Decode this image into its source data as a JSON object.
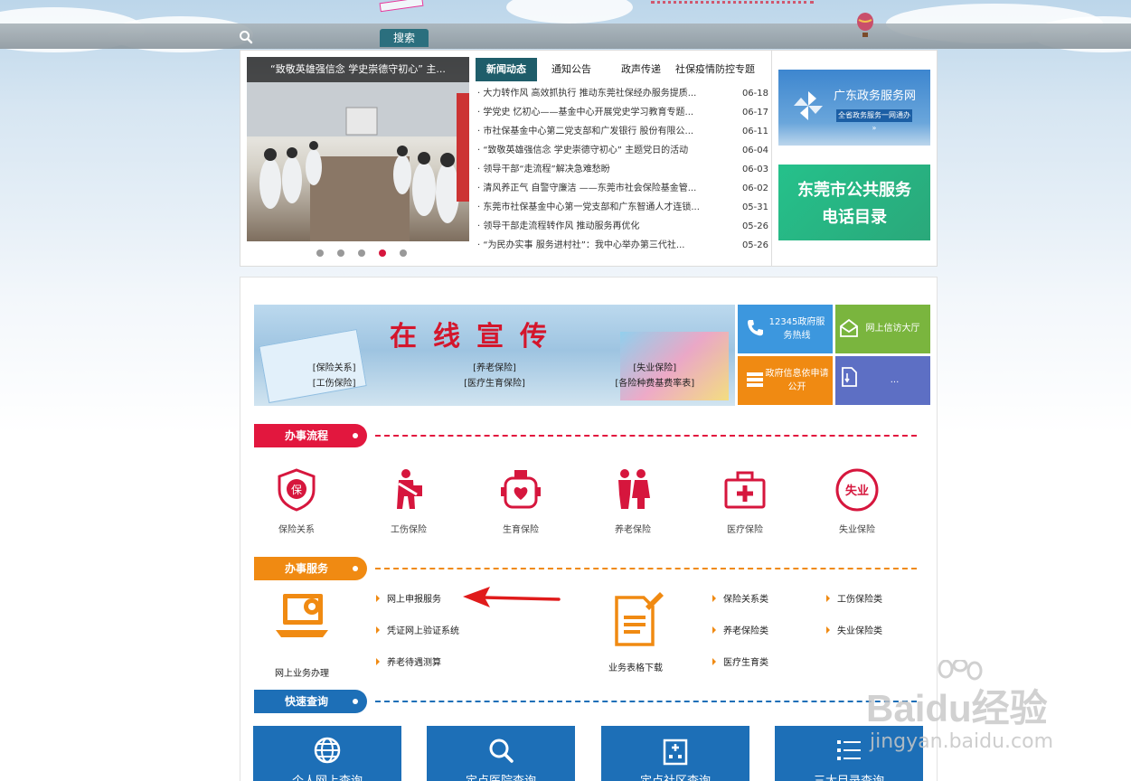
{
  "header": {
    "search_button": "搜索"
  },
  "slider": {
    "caption": "“致敬英雄强信念 学史崇德守初心” 主..."
  },
  "tabs": [
    {
      "label": "新闻动态",
      "active": true
    },
    {
      "label": "通知公告"
    },
    {
      "label": "政声传递"
    },
    {
      "label": "社保疫情防控专题"
    }
  ],
  "news": [
    {
      "title": "· 大力转作风 高效抓执行 推动东莞社保经办服务提质...",
      "date": "06-18"
    },
    {
      "title": "· 学党史 忆初心——基金中心开展党史学习教育专题...",
      "date": "06-17"
    },
    {
      "title": "· 市社保基金中心第二党支部和广发银行 股份有限公...",
      "date": "06-11"
    },
    {
      "title": "· “致敬英雄强信念 学史崇德守初心” 主题党日的活动",
      "date": "06-04"
    },
    {
      "title": "· 领导干部“走流程”解决急难愁盼",
      "date": "06-03"
    },
    {
      "title": "· 清风养正气 自警守廉洁 ——东莞市社会保险基金管...",
      "date": "06-02"
    },
    {
      "title": "· 东莞市社保基金中心第一党支部和广东智通人才连锁...",
      "date": "05-31"
    },
    {
      "title": "· 领导干部走流程转作风 推动服务再优化",
      "date": "05-26"
    },
    {
      "title": "· “为民办实事 服务进村社”：我中心举办第三代社...",
      "date": "05-26"
    }
  ],
  "right_banners": {
    "gd_title": "广东政务服务网",
    "gd_sub": "全省政务服务一网通办 »",
    "phone_line1": "东莞市公共服务",
    "phone_line2": "电话目录"
  },
  "promo": {
    "title": "在线宣传",
    "links_row1": [
      "[保险关系]",
      "[养老保险]",
      "[失业保险]"
    ],
    "links_row2": [
      "[工伤保险]",
      "[医疗生育保险]",
      "[各险种费基费率表]"
    ]
  },
  "tiles": {
    "hotline": "12345政府服务热线",
    "letters": "网上信访大厅",
    "disclosure": "政府信息依申请公开",
    "more": "..."
  },
  "sections": {
    "process": "办事流程",
    "service": "办事服务",
    "query": "快速查询"
  },
  "process_items": [
    "保险关系",
    "工伤保险",
    "生育保险",
    "养老保险",
    "医疗保险",
    "失业保险"
  ],
  "services": {
    "online_label": "网上业务办理",
    "online_links": [
      "网上申报服务",
      "凭证网上验证系统",
      "养老待遇测算"
    ],
    "forms_label": "业务表格下载",
    "forms_col1": [
      "保险关系类",
      "养老保险类",
      "医疗生育类"
    ],
    "forms_col2": [
      "工伤保险类",
      "失业保险类"
    ]
  },
  "quick_query": [
    "个人网上查询",
    "定点医院查询",
    "定点社区查询",
    "三大目录查询"
  ],
  "watermark": {
    "brand": "Baidu经验",
    "url": "jingyan.baidu.com"
  },
  "colors": {
    "teal": "#1f5d6a",
    "red": "#d6163d",
    "orange": "#f08a12",
    "blue": "#1d6fb7"
  }
}
